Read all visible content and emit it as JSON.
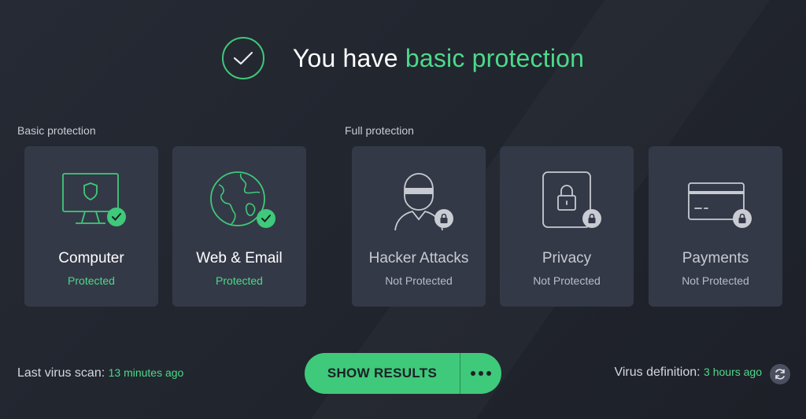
{
  "header": {
    "title_prefix": "You have",
    "title_accent": "basic protection"
  },
  "sections": {
    "basic_label": "Basic protection",
    "full_label": "Full protection"
  },
  "cards": [
    {
      "name": "Computer",
      "status": "Protected",
      "icon": "monitor-shield-icon",
      "badge": "check-icon"
    },
    {
      "name": "Web & Email",
      "status": "Protected",
      "icon": "globe-icon",
      "badge": "check-icon"
    },
    {
      "name": "Hacker Attacks",
      "status": "Not Protected",
      "icon": "hacker-icon",
      "badge": "lock-icon"
    },
    {
      "name": "Privacy",
      "status": "Not Protected",
      "icon": "padlock-document-icon",
      "badge": "lock-icon"
    },
    {
      "name": "Payments",
      "status": "Not Protected",
      "icon": "credit-card-icon",
      "badge": "lock-icon"
    }
  ],
  "footer": {
    "last_scan_label": "Last virus scan:",
    "last_scan_value": "13 minutes ago",
    "show_results_label": "SHOW RESULTS",
    "virus_def_label": "Virus definition:",
    "virus_def_value": "3 hours ago"
  },
  "colors": {
    "accent": "#4cd98a",
    "background": "#22262f",
    "card": "#343947",
    "button": "#3fc97a"
  }
}
